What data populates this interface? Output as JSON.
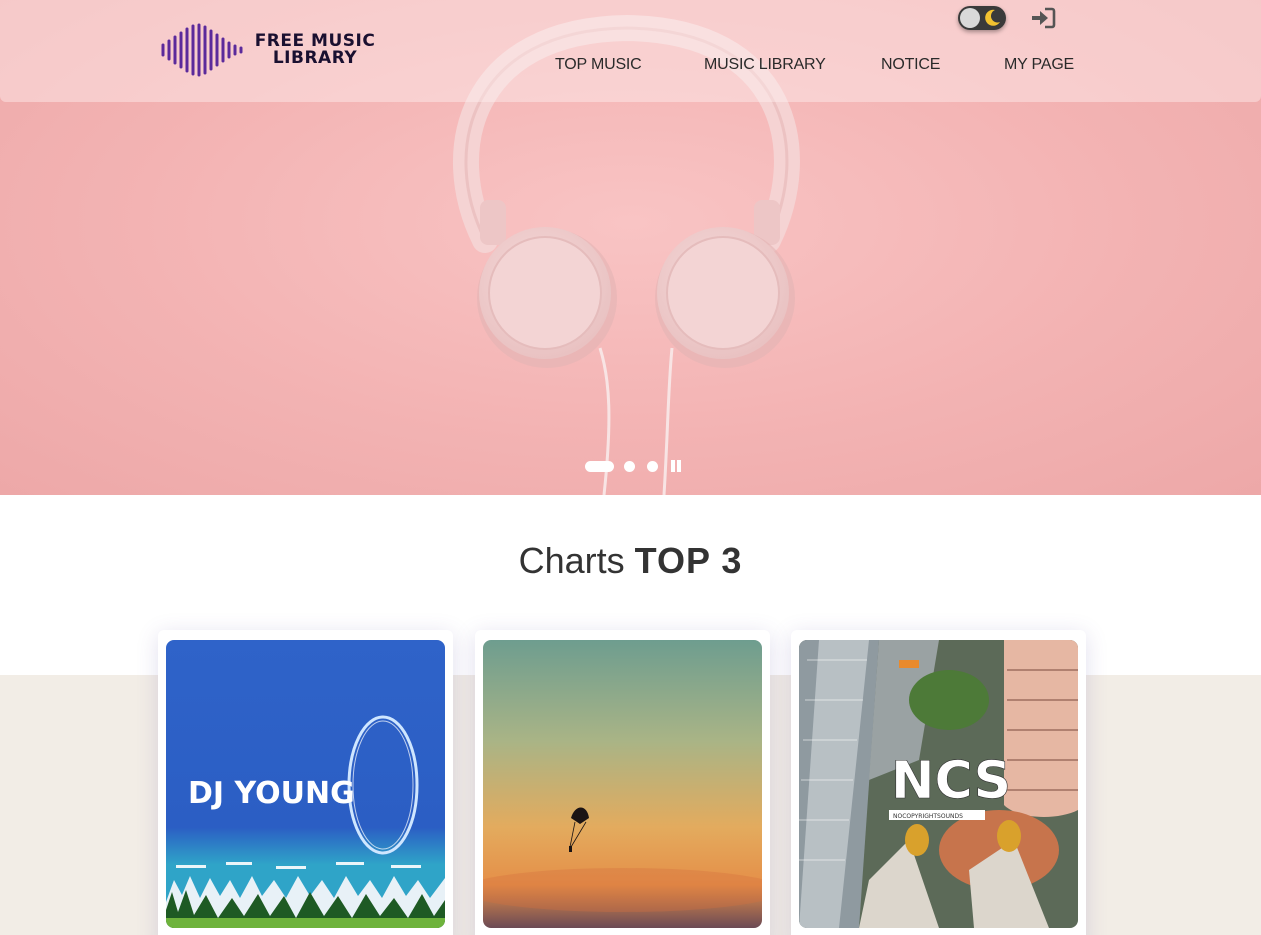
{
  "logo": {
    "line1": "FREE MUSIC",
    "line2": "LIBRARY",
    "icon": "sound-wave-icon"
  },
  "nav": {
    "items": [
      {
        "label": "TOP MUSIC"
      },
      {
        "label": "MUSIC LIBRARY"
      },
      {
        "label": "NOTICE"
      },
      {
        "label": "MY PAGE"
      }
    ]
  },
  "header_tools": {
    "theme_toggle_icon": "moon-icon",
    "login_icon": "sign-in-icon"
  },
  "hero": {
    "image": "pink headphones on pink background",
    "slides": 3,
    "active_slide": 1
  },
  "charts": {
    "title_light": "Charts",
    "title_bold": "TOP 3",
    "cards": [
      {
        "art_text": "DJ YOUNG"
      },
      {
        "art_text": ""
      },
      {
        "art_text": "NCS",
        "art_subtext": "NOCOPYRIGHTSOUNDS"
      }
    ]
  },
  "colors": {
    "hero_pink": "#f3b3b3",
    "lower_bg": "#f2ede6",
    "logo_purple": "#5b2a9b",
    "moon_yellow": "#f2c230"
  }
}
